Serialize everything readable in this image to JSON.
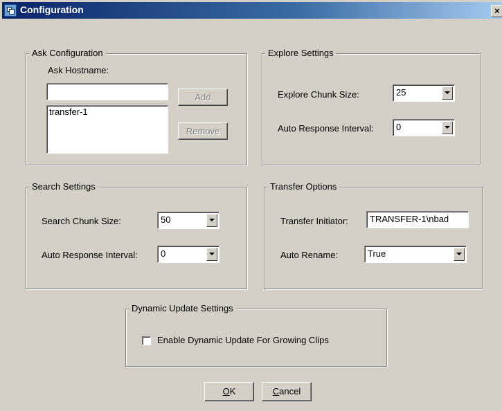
{
  "window": {
    "title": "Configuration",
    "close_label": "×"
  },
  "ask": {
    "legend": "Ask Configuration",
    "hostname_label": "Ask Hostname:",
    "hostname_value": "",
    "hosts": [
      "transfer-1"
    ],
    "add_label": "Add",
    "remove_label": "Remove"
  },
  "explore": {
    "legend": "Explore Settings",
    "chunk_label": "Explore Chunk Size:",
    "chunk_value": "25",
    "interval_label": "Auto Response Interval:",
    "interval_value": "0"
  },
  "search": {
    "legend": "Search Settings",
    "chunk_label": "Search Chunk Size:",
    "chunk_value": "50",
    "interval_label": "Auto Response Interval:",
    "interval_value": "0"
  },
  "transfer": {
    "legend": "Transfer Options",
    "initiator_label": "Transfer Initiator:",
    "initiator_value": "TRANSFER-1\\nbad",
    "rename_label": "Auto Rename:",
    "rename_value": "True"
  },
  "dynamic": {
    "legend": "Dynamic Update Settings",
    "checkbox_label": "Enable Dynamic Update For Growing Clips",
    "checked": false
  },
  "buttons": {
    "ok_mnemonic": "O",
    "ok_rest": "K",
    "cancel_mnemonic": "C",
    "cancel_rest": "ancel"
  }
}
